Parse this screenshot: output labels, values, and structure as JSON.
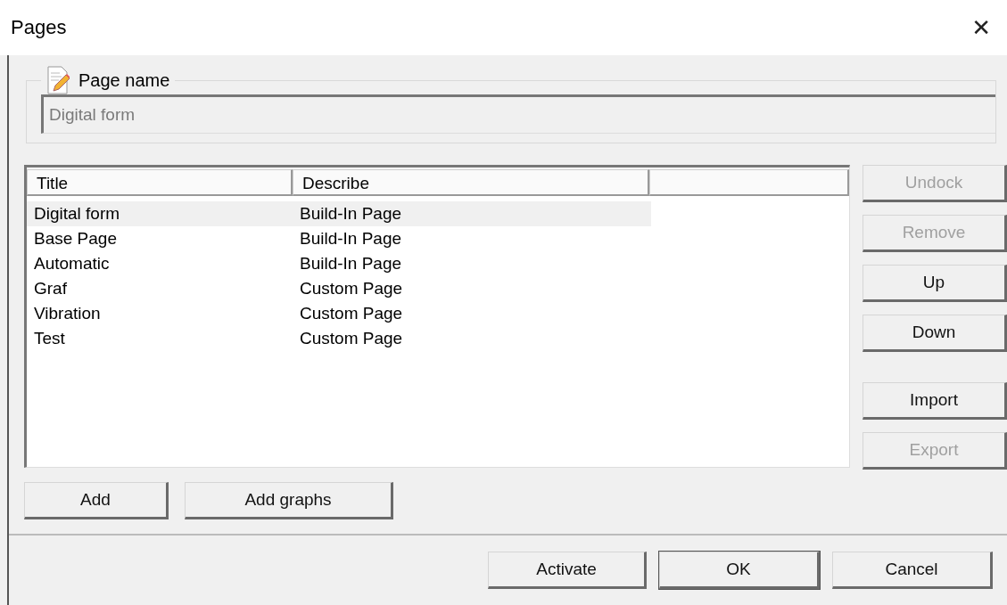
{
  "window": {
    "title": "Pages",
    "close": "✕"
  },
  "page_name": {
    "label": "Page name",
    "value": "Digital form",
    "disabled": true
  },
  "table": {
    "columns": [
      "Title",
      "Describe"
    ],
    "rows": [
      {
        "title": "Digital form",
        "describe": "Build-In Page",
        "selected": true
      },
      {
        "title": "Base Page",
        "describe": "Build-In Page",
        "selected": false
      },
      {
        "title": "Automatic",
        "describe": "Build-In Page",
        "selected": false
      },
      {
        "title": "Graf",
        "describe": "Custom Page",
        "selected": false
      },
      {
        "title": "Vibration",
        "describe": "Custom Page",
        "selected": false
      },
      {
        "title": "Test",
        "describe": "Custom Page",
        "selected": false
      }
    ]
  },
  "side_buttons": [
    {
      "label": "Undock",
      "disabled": true
    },
    {
      "label": "Remove",
      "disabled": true
    },
    {
      "label": "Up",
      "disabled": false
    },
    {
      "label": "Down",
      "disabled": false
    },
    {
      "label": "Import",
      "disabled": false
    },
    {
      "label": "Export",
      "disabled": true
    }
  ],
  "list_buttons": [
    "Add",
    "Add graphs"
  ],
  "dialog_buttons": [
    {
      "label": "Activate",
      "default": false
    },
    {
      "label": "OK",
      "default": true
    },
    {
      "label": "Cancel",
      "default": false
    }
  ]
}
